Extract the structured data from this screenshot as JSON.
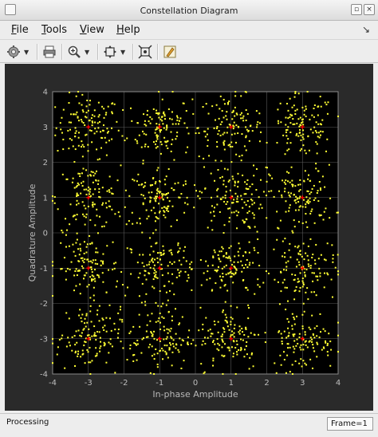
{
  "window": {
    "title": "Constellation Diagram"
  },
  "menu": [
    {
      "label_u": "F",
      "label_rest": "ile",
      "name": "menu-file"
    },
    {
      "label_u": "T",
      "label_rest": "ools",
      "name": "menu-tools"
    },
    {
      "label_u": "V",
      "label_rest": "iew",
      "name": "menu-view"
    },
    {
      "label_u": "H",
      "label_rest": "elp",
      "name": "menu-help"
    }
  ],
  "toolbar": {
    "icons": [
      "gear-icon",
      "print-icon",
      "zoom-in-icon",
      "pan-icon",
      "autoscale-icon",
      "highlight-icon"
    ]
  },
  "status": {
    "text": "Processing",
    "frame": "Frame=1"
  },
  "colors": {
    "plot_bg": "#000000",
    "figure_bg": "#2a2a2a",
    "points": "#ffff33",
    "reference": "#ff0000",
    "grid": "#5a5a5a"
  },
  "chart_data": {
    "type": "scatter",
    "title": "",
    "xlabel": "In-phase Amplitude",
    "ylabel": "Quadrature Amplitude",
    "xlim": [
      -4,
      4
    ],
    "ylim": [
      -4,
      4
    ],
    "xticks": [
      -4,
      -3,
      -2,
      -1,
      0,
      1,
      2,
      3,
      4
    ],
    "yticks": [
      -4,
      -3,
      -2,
      -1,
      0,
      1,
      2,
      3,
      4
    ],
    "grid": true,
    "reference_points": [
      [
        -3,
        3
      ],
      [
        -1,
        3
      ],
      [
        1,
        3
      ],
      [
        3,
        3
      ],
      [
        -3,
        1
      ],
      [
        -1,
        1
      ],
      [
        1,
        1
      ],
      [
        3,
        1
      ],
      [
        -3,
        -1
      ],
      [
        -1,
        -1
      ],
      [
        1,
        -1
      ],
      [
        3,
        -1
      ],
      [
        -3,
        -3
      ],
      [
        -1,
        -3
      ],
      [
        1,
        -3
      ],
      [
        3,
        -3
      ]
    ],
    "received_points_per_symbol": 120,
    "received_spread": 0.45
  }
}
